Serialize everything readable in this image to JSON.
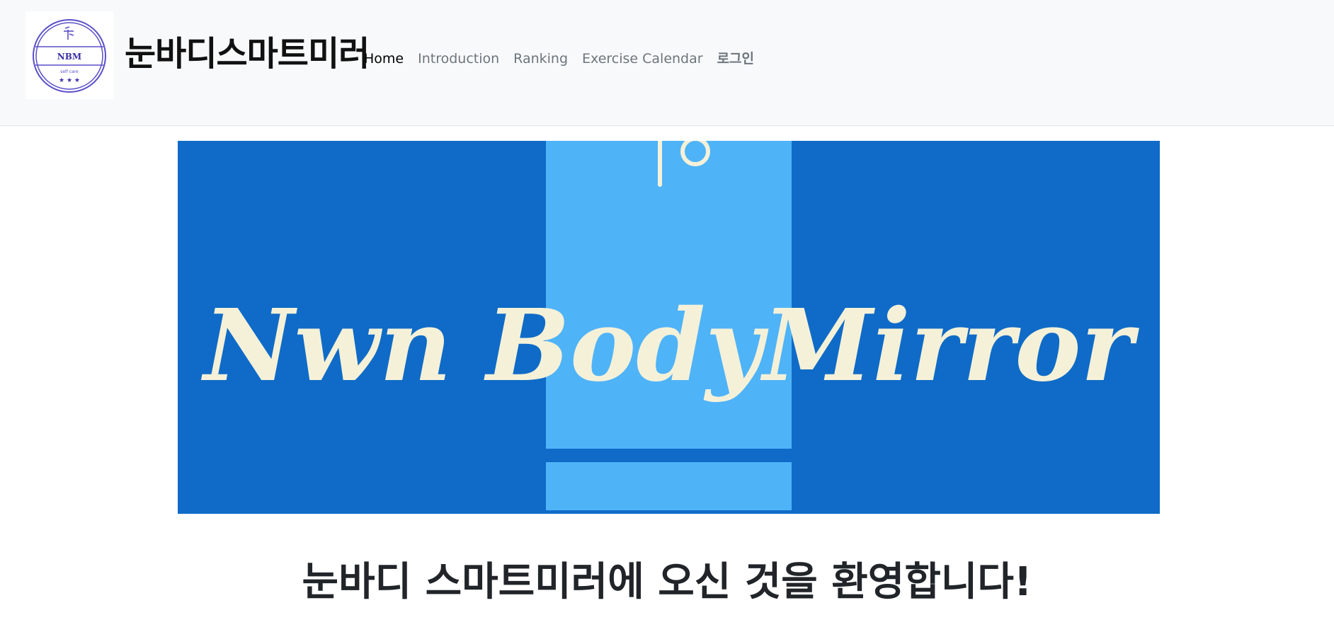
{
  "header": {
    "logo": {
      "top_text": "NBM",
      "sub_text": "self care",
      "stars": "★ ★ ★",
      "icon": "leaf-icon"
    },
    "brand_name": "눈바디스마트미러",
    "nav": [
      {
        "label": "Home",
        "active": true
      },
      {
        "label": "Introduction",
        "active": false
      },
      {
        "label": "Ranking",
        "active": false
      },
      {
        "label": "Exercise Calendar",
        "active": false
      },
      {
        "label": "로그인",
        "active": false
      }
    ]
  },
  "banner": {
    "text": "Nwn BodyMirror",
    "colors": {
      "background": "#0f6bc7",
      "panel": "#4fb3f8",
      "text": "#f5f1d8"
    }
  },
  "main": {
    "welcome_heading": "눈바디 스마트미러에 오신 것을 환영합니다!"
  }
}
